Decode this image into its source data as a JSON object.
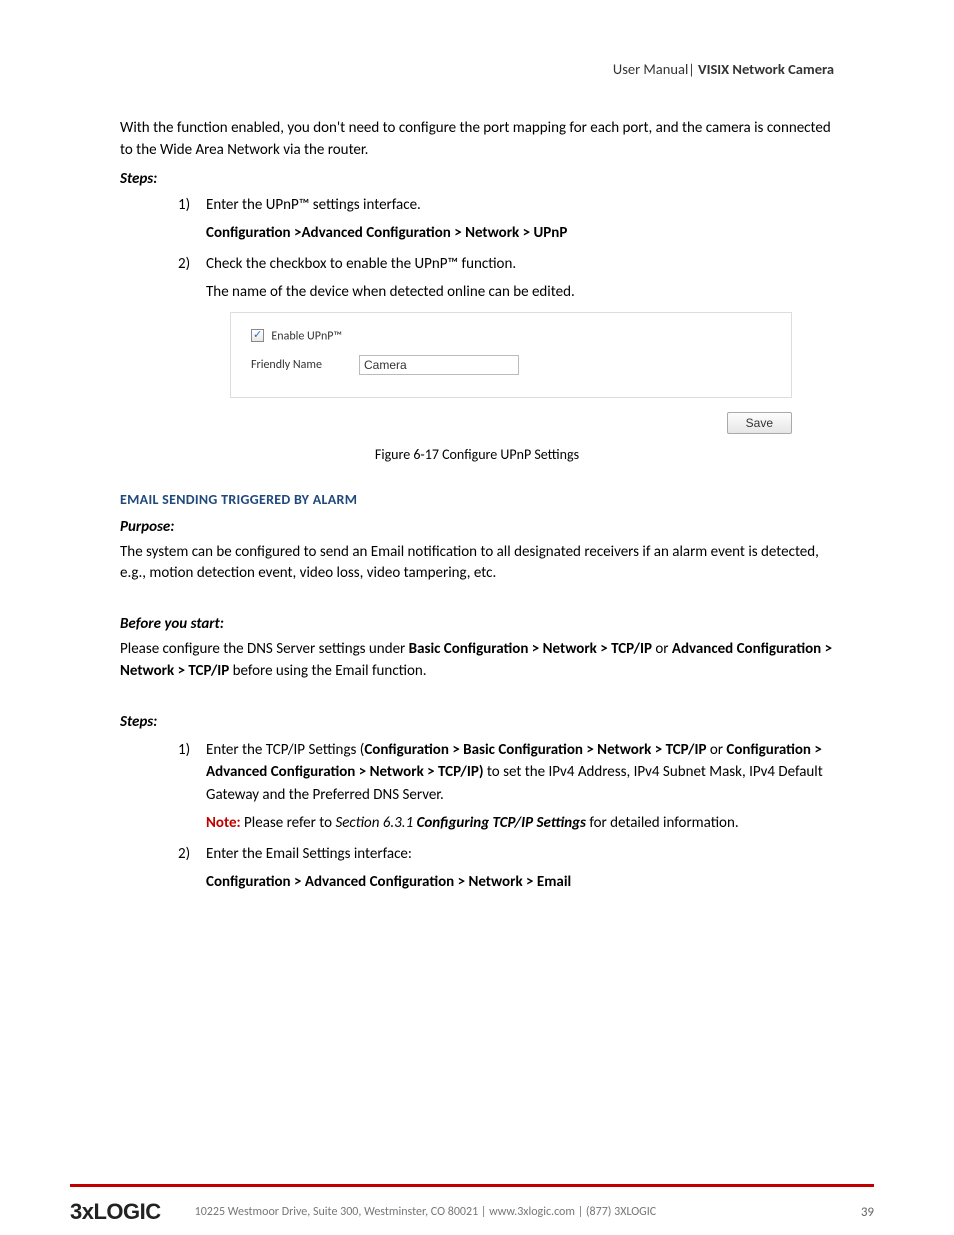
{
  "header": {
    "left": "User Manual",
    "pipe": "|",
    "right": "VISIX Network Camera"
  },
  "intro": "With the function enabled, you don't need to configure the port mapping for each port, and the camera is connected to the Wide Area Network via the router.",
  "steps_label": "Steps:",
  "step1_num": "1)",
  "step1_text": "Enter the UPnP™ settings interface.",
  "step1_path": "Configuration >Advanced Configuration > Network > UPnP",
  "step2_num": "2)",
  "step2_text": "Check the checkbox to enable the UPnP™ function.",
  "step2_sub": "The name of the device when detected online can be edited.",
  "upnp": {
    "checkbox_label": "Enable UPnP™",
    "friendly_label": "Friendly Name",
    "friendly_value": "Camera",
    "save": "Save"
  },
  "figure_caption_prefix": "Figure 6-17 ",
  "figure_caption_text": "Configure UPnP Settings",
  "section_title": "EMAIL SENDING TRIGGERED BY ALARM",
  "purpose_label": "Purpose:",
  "purpose_text": "The system can be configured to send an Email notification to all designated receivers if an alarm event is detected, e.g., motion detection event, video loss, video tampering, etc.",
  "before_label": "Before you start:",
  "before_pre": "Please configure the DNS Server settings under ",
  "before_bold1": "Basic Configuration > Network > TCP/IP",
  "before_mid": " or ",
  "before_bold2": "Advanced Configuration > Network > TCP/IP",
  "before_post": " before using the Email function.",
  "steps2_label": " Steps:",
  "s2_step1_num": "1)",
  "s2_step1_pre": "Enter the TCP/IP Settings (",
  "s2_step1_b1": "Configuration > Basic Configuration > Network > TCP/IP",
  "s2_step1_mid": " or ",
  "s2_step1_b2": "Configuration > Advanced Configuration > Network > TCP/IP)",
  "s2_step1_post": " to set the IPv4 Address, IPv4 Subnet Mask, IPv4 Default Gateway and the Preferred DNS Server.",
  "note_label": "Note:",
  "note_pre": " Please refer to ",
  "note_italic": "Section 6.3.1 ",
  "note_bolditalic": "Configuring TCP/IP Settings",
  "note_post": " for detailed information.",
  "s2_step2_num": "2)",
  "s2_step2_text": "Enter the Email Settings interface:",
  "s2_step2_path": "Configuration > Advanced Configuration > Network > Email",
  "footer": {
    "logo": "3xLOGIC",
    "text": "10225 Westmoor Drive, Suite 300, Westminster, CO 80021 | www.3xlogic.com | (877) 3XLOGIC",
    "page": "39"
  }
}
